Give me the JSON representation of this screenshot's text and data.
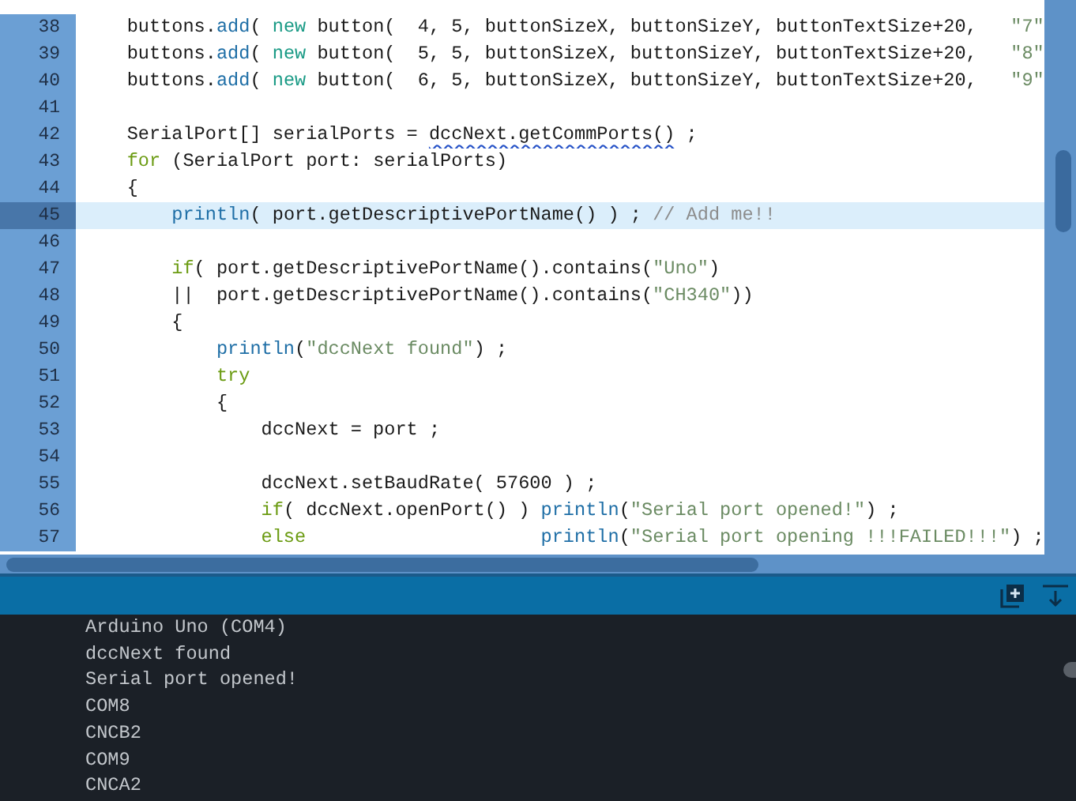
{
  "editor": {
    "lines": [
      {
        "number": "38",
        "highlighted": false,
        "segments": [
          {
            "kind": "plain",
            "text": "    buttons."
          },
          {
            "kind": "function",
            "text": "add"
          },
          {
            "kind": "plain",
            "text": "( "
          },
          {
            "kind": "new",
            "text": "new"
          },
          {
            "kind": "plain",
            "text": " button(  4, 5, buttonSizeX, buttonSizeY, buttonTextSize+20,   "
          },
          {
            "kind": "string",
            "text": "\"7\""
          }
        ]
      },
      {
        "number": "39",
        "highlighted": false,
        "segments": [
          {
            "kind": "plain",
            "text": "    buttons."
          },
          {
            "kind": "function",
            "text": "add"
          },
          {
            "kind": "plain",
            "text": "( "
          },
          {
            "kind": "new",
            "text": "new"
          },
          {
            "kind": "plain",
            "text": " button(  5, 5, buttonSizeX, buttonSizeY, buttonTextSize+20,   "
          },
          {
            "kind": "string",
            "text": "\"8\""
          }
        ]
      },
      {
        "number": "40",
        "highlighted": false,
        "segments": [
          {
            "kind": "plain",
            "text": "    buttons."
          },
          {
            "kind": "function",
            "text": "add"
          },
          {
            "kind": "plain",
            "text": "( "
          },
          {
            "kind": "new",
            "text": "new"
          },
          {
            "kind": "plain",
            "text": " button(  6, 5, buttonSizeX, buttonSizeY, buttonTextSize+20,   "
          },
          {
            "kind": "string",
            "text": "\"9\""
          }
        ]
      },
      {
        "number": "41",
        "highlighted": false
      },
      {
        "number": "42",
        "highlighted": false,
        "segments": [
          {
            "kind": "plain",
            "text": "    SerialPort[] serialPorts = "
          },
          {
            "kind": "squiggle",
            "text": "dccNext.getCommPorts()"
          },
          {
            "kind": "plain",
            "text": " ;"
          }
        ]
      },
      {
        "number": "43",
        "highlighted": false,
        "segments": [
          {
            "kind": "keyword",
            "text": "    for"
          },
          {
            "kind": "plain",
            "text": " (SerialPort port: serialPorts)"
          }
        ]
      },
      {
        "number": "44",
        "highlighted": false,
        "segments": [
          {
            "kind": "plain",
            "text": "    {"
          }
        ]
      },
      {
        "number": "45",
        "highlighted": true,
        "segments": [
          {
            "kind": "function",
            "text": "        println"
          },
          {
            "kind": "plain",
            "text": "( port.getDescriptivePortName() ) ; "
          },
          {
            "kind": "comment",
            "text": "// Add me!!"
          }
        ]
      },
      {
        "number": "46",
        "highlighted": false
      },
      {
        "number": "47",
        "highlighted": false,
        "segments": [
          {
            "kind": "keyword",
            "text": "        if"
          },
          {
            "kind": "plain",
            "text": "( port.getDescriptivePortName().contains("
          },
          {
            "kind": "string",
            "text": "\"Uno\""
          },
          {
            "kind": "plain",
            "text": ")"
          }
        ]
      },
      {
        "number": "48",
        "highlighted": false,
        "segments": [
          {
            "kind": "plain",
            "text": "        ||  port.getDescriptivePortName().contains("
          },
          {
            "kind": "string",
            "text": "\"CH340\""
          },
          {
            "kind": "plain",
            "text": "))"
          }
        ]
      },
      {
        "number": "49",
        "highlighted": false,
        "segments": [
          {
            "kind": "plain",
            "text": "        {"
          }
        ]
      },
      {
        "number": "50",
        "highlighted": false,
        "segments": [
          {
            "kind": "function",
            "text": "            println"
          },
          {
            "kind": "plain",
            "text": "("
          },
          {
            "kind": "string",
            "text": "\"dccNext found\""
          },
          {
            "kind": "plain",
            "text": ") ;"
          }
        ]
      },
      {
        "number": "51",
        "highlighted": false,
        "segments": [
          {
            "kind": "keyword",
            "text": "            try"
          }
        ]
      },
      {
        "number": "52",
        "highlighted": false,
        "segments": [
          {
            "kind": "plain",
            "text": "            {"
          }
        ]
      },
      {
        "number": "53",
        "highlighted": false,
        "segments": [
          {
            "kind": "plain",
            "text": "                dccNext = port ;"
          }
        ]
      },
      {
        "number": "54",
        "highlighted": false
      },
      {
        "number": "55",
        "highlighted": false,
        "segments": [
          {
            "kind": "plain",
            "text": "                dccNext.setBaudRate( 57600 ) ;"
          }
        ]
      },
      {
        "number": "56",
        "highlighted": false,
        "segments": [
          {
            "kind": "keyword",
            "text": "                if"
          },
          {
            "kind": "plain",
            "text": "( dccNext.openPort() ) "
          },
          {
            "kind": "function",
            "text": "println"
          },
          {
            "kind": "plain",
            "text": "("
          },
          {
            "kind": "string",
            "text": "\"Serial port opened!\""
          },
          {
            "kind": "plain",
            "text": ") ;"
          }
        ]
      },
      {
        "number": "57",
        "highlighted": false,
        "segments": [
          {
            "kind": "keyword",
            "text": "                else"
          },
          {
            "kind": "function",
            "text": "                     println"
          },
          {
            "kind": "plain",
            "text": "("
          },
          {
            "kind": "string",
            "text": "\"Serial port opening !!!FAILED!!!\""
          },
          {
            "kind": "plain",
            "text": ") ;"
          }
        ]
      }
    ]
  },
  "console": {
    "lines": [
      "Arduino Uno (COM4)",
      "dccNext found",
      "Serial port opened!",
      "COM8",
      "CNCB2",
      "COM9",
      "CNCA2"
    ]
  }
}
